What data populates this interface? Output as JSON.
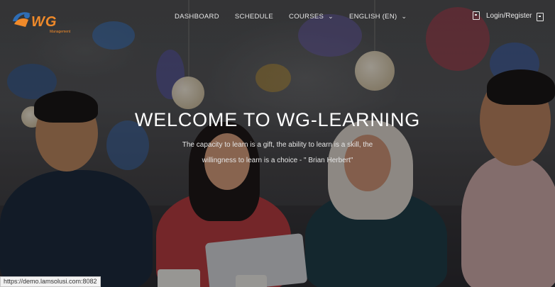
{
  "brand": {
    "logo_text": "WG",
    "logo_sub": "Management"
  },
  "nav": {
    "items": [
      {
        "label": "DASHBOARD",
        "dropdown": false
      },
      {
        "label": "SCHEDULE",
        "dropdown": false
      },
      {
        "label": "COURSES",
        "dropdown": true
      },
      {
        "label": "ENGLISH (EN)",
        "dropdown": true
      }
    ],
    "login_label": "Login/Register"
  },
  "hero": {
    "title": "WELCOME TO WG-LEARNING",
    "quote_line1": "The capacity to learn is a gift, the ability to learn is a skill, the",
    "quote_line2": "willingness to learn is a choice - \" Brian Herbert\""
  },
  "status_url": "https://demo.lamsolusi.com:8082",
  "colors": {
    "brand_orange": "#f08a2a",
    "nav_text": "#e8e8e8"
  }
}
